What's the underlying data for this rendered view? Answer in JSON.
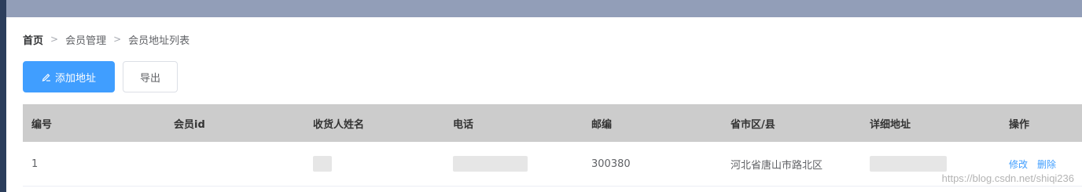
{
  "breadcrumb": [
    "首页",
    "会员管理",
    "会员地址列表"
  ],
  "toolbar": {
    "add_label": "添加地址",
    "export_label": "导出"
  },
  "table": {
    "headers": [
      "编号",
      "会员id",
      "收货人姓名",
      "电话",
      "邮编",
      "省市区/县",
      "详细地址",
      "操作"
    ],
    "rows": [
      {
        "id": "1",
        "postcode": "300380",
        "region": "河北省唐山市路北区",
        "edit": "修改",
        "delete": "删除"
      }
    ]
  },
  "watermark": "https://blog.csdn.net/shiqi236",
  "colors": {
    "primary": "#409eff",
    "topbar": "#929eb8",
    "header_bg": "#cccccc"
  }
}
